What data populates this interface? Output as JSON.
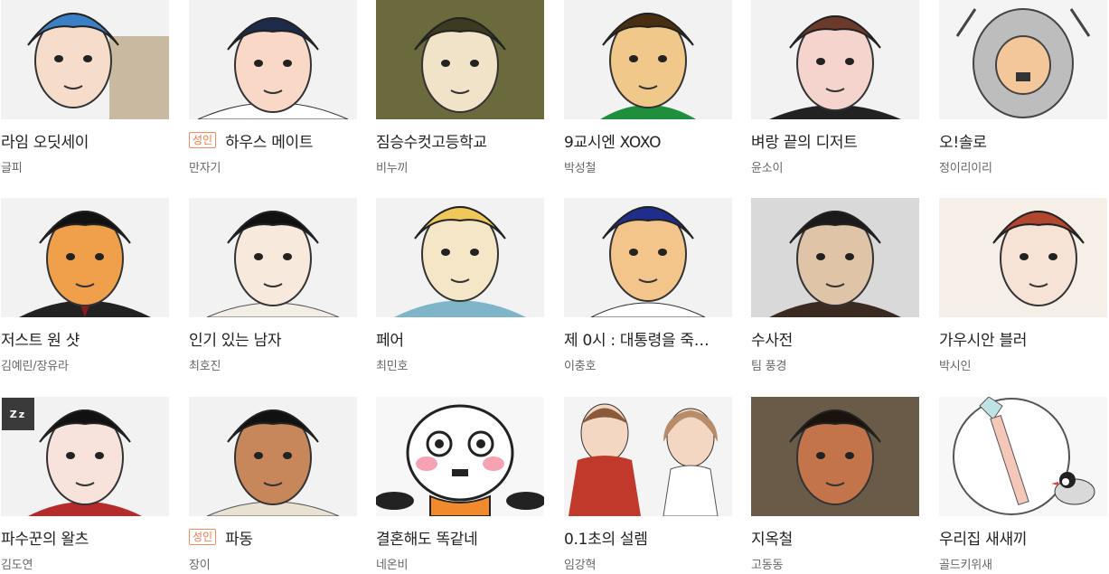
{
  "colors": {
    "accent_adult": "#f1784a",
    "title_text": "#222222",
    "author_text": "#666666"
  },
  "webtoons": [
    {
      "title": "라임 오딧세이",
      "author": "글피",
      "adult": false,
      "badge": "",
      "sleep": false,
      "sleep_label": "",
      "art": "blue-hair-boy"
    },
    {
      "title": "하우스 메이트",
      "author": "만자기",
      "adult": true,
      "badge": "성인",
      "sleep": false,
      "sleep_label": "",
      "art": "dark-hair-boy"
    },
    {
      "title": "짐승수컷고등학교",
      "author": "비누끼",
      "adult": false,
      "badge": "",
      "sleep": false,
      "sleep_label": "",
      "art": "green-hair-boy"
    },
    {
      "title": "9교시엔 XOXO",
      "author": "박성철",
      "adult": false,
      "badge": "",
      "sleep": false,
      "sleep_label": "",
      "art": "brown-hair-boy"
    },
    {
      "title": "벼랑 끝의 디저트",
      "author": "윤소이",
      "adult": false,
      "badge": "",
      "sleep": false,
      "sleep_label": "",
      "art": "pale-boy"
    },
    {
      "title": "오!솔로",
      "author": "정이리이리",
      "adult": false,
      "badge": "",
      "sleep": false,
      "sleep_label": "",
      "art": "hoodie-character"
    },
    {
      "title": "저스트 원 샷",
      "author": "김예린/장유라",
      "adult": false,
      "badge": "",
      "sleep": false,
      "sleep_label": "",
      "art": "orange-face-man"
    },
    {
      "title": "인기 있는 남자",
      "author": "최호진",
      "adult": false,
      "badge": "",
      "sleep": false,
      "sleep_label": "",
      "art": "sketch-man"
    },
    {
      "title": "페어",
      "author": "최민호",
      "adult": false,
      "badge": "",
      "sleep": false,
      "sleep_label": "",
      "art": "yellow-hair-girl"
    },
    {
      "title": "제 0시 : 대통령을 죽…",
      "author": "이충호",
      "adult": false,
      "badge": "",
      "sleep": false,
      "sleep_label": "",
      "art": "blue-hair-man"
    },
    {
      "title": "수사전",
      "author": "팀 풍경",
      "adult": false,
      "badge": "",
      "sleep": false,
      "sleep_label": "",
      "art": "glasses-man"
    },
    {
      "title": "가우시안 블러",
      "author": "박시인",
      "adult": false,
      "badge": "",
      "sleep": false,
      "sleep_label": "",
      "art": "red-hair-girl"
    },
    {
      "title": "파수꾼의 왈츠",
      "author": "김도연",
      "adult": false,
      "badge": "",
      "sleep": true,
      "sleep_label": "Zz",
      "art": "black-hair-girl"
    },
    {
      "title": "파동",
      "author": "장이",
      "adult": true,
      "badge": "성인",
      "sleep": false,
      "sleep_label": "",
      "art": "tan-man"
    },
    {
      "title": "결혼해도 똑같네",
      "author": "네온비",
      "adult": false,
      "badge": "",
      "sleep": false,
      "sleep_label": "",
      "art": "cartoon-girl"
    },
    {
      "title": "0.1초의 설렘",
      "author": "임강혁",
      "adult": false,
      "badge": "",
      "sleep": false,
      "sleep_label": "",
      "art": "couple"
    },
    {
      "title": "지옥철",
      "author": "고동동",
      "adult": false,
      "badge": "",
      "sleep": false,
      "sleep_label": "",
      "art": "gritty-man"
    },
    {
      "title": "우리집 새새끼",
      "author": "골드키위새",
      "adult": false,
      "badge": "",
      "sleep": false,
      "sleep_label": "",
      "art": "bird-toothbrush"
    }
  ]
}
